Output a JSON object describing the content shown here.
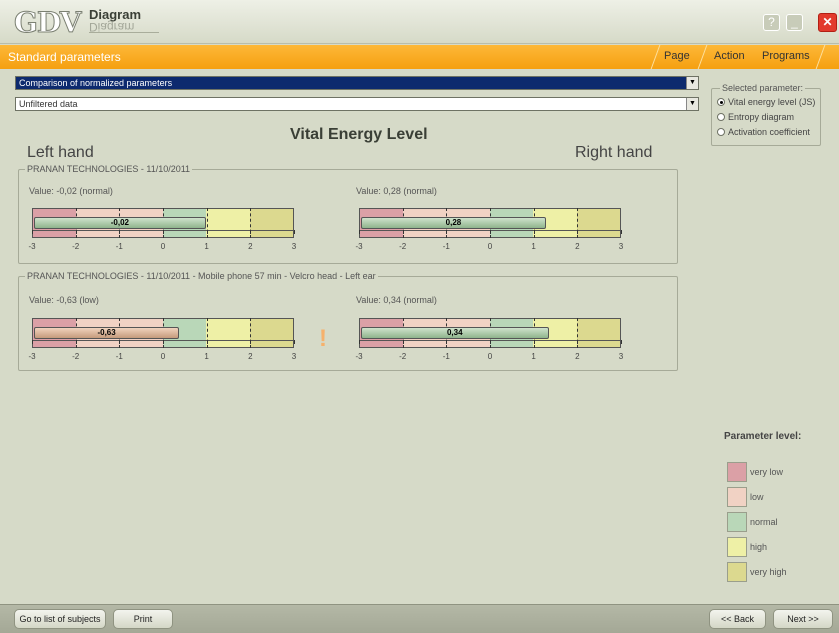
{
  "app": {
    "logo": "GDV",
    "logo_word": "Diagram"
  },
  "window_buttons": {
    "help": "?",
    "minimize": "_",
    "maximize": "❐",
    "close": "✕"
  },
  "menu": {
    "section_title": "Standard parameters",
    "items": [
      "Page",
      "Action",
      "Programs"
    ]
  },
  "dropdowns": {
    "parameter": {
      "value": "Comparison of normalized parameters"
    },
    "filter": {
      "value": "Unfiltered data"
    }
  },
  "selected_parameter": {
    "title": "Selected parameter:",
    "options": [
      {
        "label": "Vital energy level (JS)",
        "checked": true
      },
      {
        "label": "Entropy diagram",
        "checked": false
      },
      {
        "label": "Activation coefficient",
        "checked": false
      }
    ]
  },
  "heading": "Vital Energy Level",
  "left_hand": "Left hand",
  "right_hand": "Right hand",
  "scale_ticks": [
    "-3",
    "-2",
    "-1",
    "0",
    "1",
    "2",
    "3"
  ],
  "measurements": [
    {
      "title": "PRANAN TECHNOLOGIES - 11/10/2011",
      "left": {
        "value_text": "Value: -0,02 (normal)",
        "value": -0.02,
        "bar_label": "-0,02",
        "level": "normal"
      },
      "right": {
        "value_text": "Value: 0,28 (normal)",
        "value": 0.28,
        "bar_label": "0,28",
        "level": "normal"
      },
      "alert": ""
    },
    {
      "title": "PRANAN TECHNOLOGIES - 11/10/2011 - Mobile phone 57 min - Velcro head - Left ear",
      "left": {
        "value_text": "Value: -0,63 (low)",
        "value": -0.63,
        "bar_label": "-0,63",
        "level": "low"
      },
      "right": {
        "value_text": "Value: 0,34 (normal)",
        "value": 0.34,
        "bar_label": "0,34",
        "level": "normal"
      },
      "alert": "!"
    }
  ],
  "legend": {
    "title": "Parameter level:",
    "items": [
      {
        "label": "very low",
        "color": "#dba0a6"
      },
      {
        "label": "low",
        "color": "#f1d2c4"
      },
      {
        "label": "normal",
        "color": "#b9d7b8"
      },
      {
        "label": "high",
        "color": "#eef0a6"
      },
      {
        "label": "very high",
        "color": "#dcd98f"
      }
    ]
  },
  "buttons": {
    "subjects": "Go to list of subjects",
    "print": "Print",
    "back": "<< Back",
    "next": "Next >>"
  }
}
